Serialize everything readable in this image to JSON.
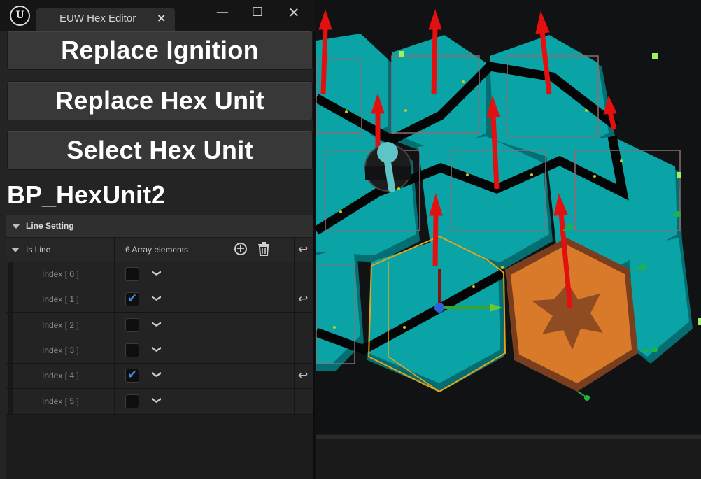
{
  "window": {
    "tab_title": "EUW Hex Editor",
    "tab_close": "×",
    "minimize": "—",
    "maximize": "☐",
    "close": "✕",
    "logo": "U"
  },
  "buttons": {
    "replace_ignition": "Replace Ignition",
    "replace_hex_unit": "Replace Hex Unit",
    "select_hex_unit": "Select Hex Unit"
  },
  "selected_unit": "BP_HexUnit2",
  "details": {
    "section_title": "Line Setting",
    "property": {
      "label": "Is Line",
      "summary": "6 Array elements"
    },
    "elements": [
      {
        "label": "Index [ 0 ]",
        "checked": false,
        "modified": false
      },
      {
        "label": "Index [ 1 ]",
        "checked": true,
        "modified": true
      },
      {
        "label": "Index [ 2 ]",
        "checked": false,
        "modified": false
      },
      {
        "label": "Index [ 3 ]",
        "checked": false,
        "modified": false
      },
      {
        "label": "Index [ 4 ]",
        "checked": true,
        "modified": true
      },
      {
        "label": "Index [ 5 ]",
        "checked": false,
        "modified": false
      }
    ]
  },
  "icons": {
    "add": "add-element-icon",
    "delete": "trash-icon",
    "reset": "reset-to-default-icon",
    "dropdown": "chevron-down-icon"
  },
  "colors": {
    "hex_tile": "#0aa3a6",
    "hex_selected_outline": "#e8a317",
    "ignition_tile": "#d87a2a",
    "z_arrow": "#e31010",
    "checkbox_check": "#3d8de0"
  }
}
